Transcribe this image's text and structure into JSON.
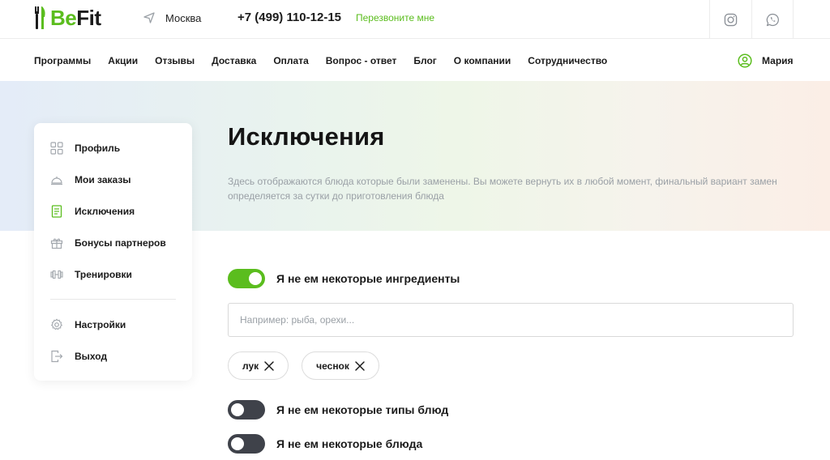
{
  "brand": {
    "name_part1": "Be",
    "name_part2": "Fit",
    "accent": "#5bbd1e"
  },
  "header": {
    "city": "Москва",
    "phone": "+7 (499) 110-12-15",
    "callback": "Перезвоните мне",
    "social_icons": [
      "instagram-icon",
      "whatsapp-icon"
    ]
  },
  "nav": {
    "items": [
      "Программы",
      "Акции",
      "Отзывы",
      "Доставка",
      "Оплата",
      "Вопрос - ответ",
      "Блог",
      "О компании",
      "Сотрудничество"
    ],
    "user": "Мария"
  },
  "sidebar": {
    "items": [
      {
        "label": "Профиль",
        "icon": "grid-icon"
      },
      {
        "label": "Мои заказы",
        "icon": "dish-icon"
      },
      {
        "label": "Исключения",
        "icon": "checklist-icon"
      },
      {
        "label": "Бонусы партнеров",
        "icon": "gift-icon"
      },
      {
        "label": "Тренировки",
        "icon": "dumbbell-icon"
      },
      {
        "label": "Настройки",
        "icon": "gear-icon"
      },
      {
        "label": "Выход",
        "icon": "logout-icon"
      }
    ]
  },
  "main": {
    "title": "Исключения",
    "description": "Здесь отображаются блюда которые были заменены. Вы можете вернуть их в любой момент, финальный вариант замен определяется за сутки до приготовления блюда",
    "toggles": [
      {
        "label": "Я не ем некоторые ингредиенты",
        "on": true
      },
      {
        "label": "Я не ем некоторые типы блюд",
        "on": false
      },
      {
        "label": "Я не ем некоторые блюда",
        "on": false
      }
    ],
    "ingredient_input": {
      "placeholder": "Например: рыба, орехи...",
      "value": ""
    },
    "chips": [
      "лук",
      "чеснок"
    ]
  }
}
